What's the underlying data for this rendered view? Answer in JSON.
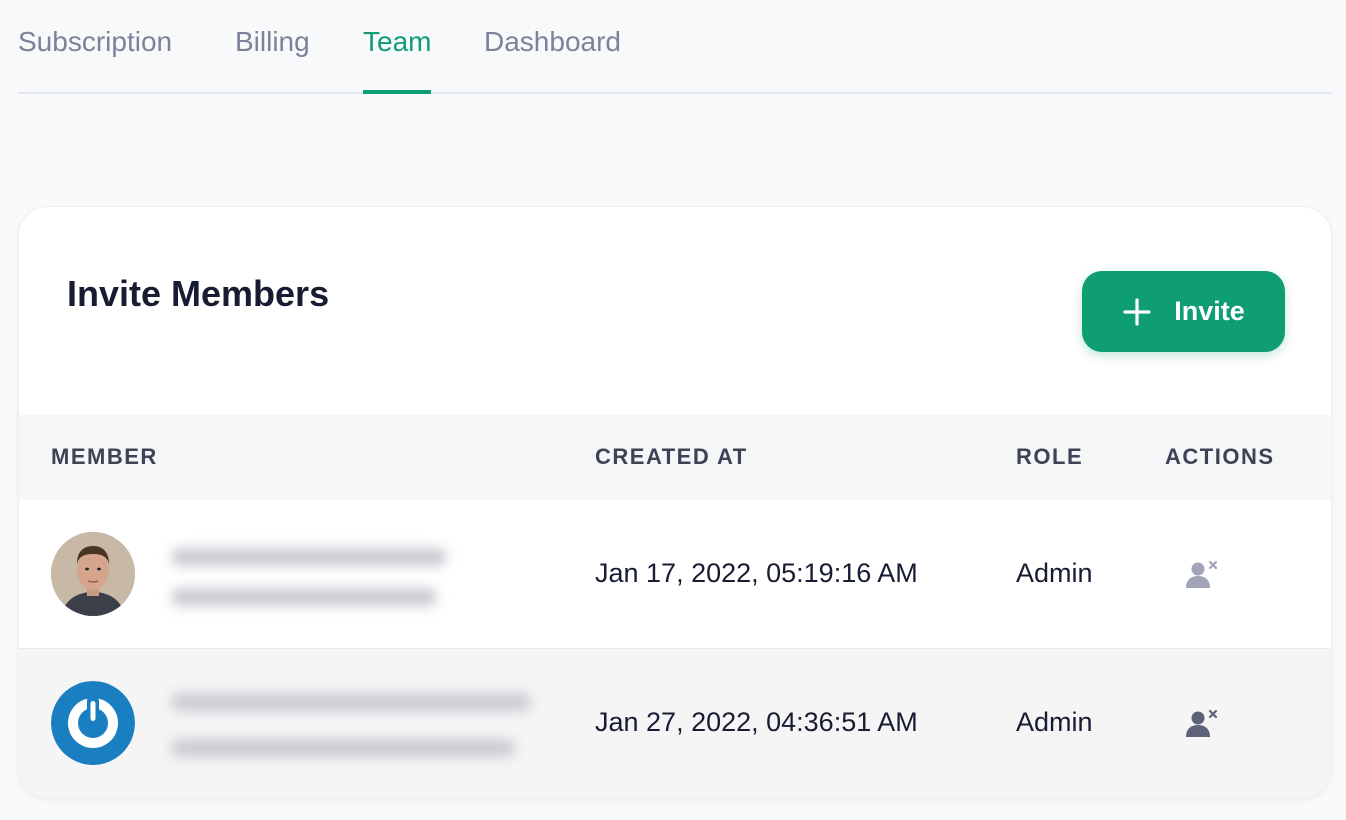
{
  "tabs": [
    {
      "label": "Subscription",
      "active": false
    },
    {
      "label": "Billing",
      "active": false
    },
    {
      "label": "Team",
      "active": true
    },
    {
      "label": "Dashboard",
      "active": false
    }
  ],
  "colors": {
    "accent": "#0f9d73",
    "text": "#181c32",
    "muted": "#7e8299",
    "icon": "#a1a5b7"
  },
  "card": {
    "title": "Invite Members",
    "invite_button": {
      "label": "Invite",
      "icon": "plus-icon"
    }
  },
  "table": {
    "columns": [
      "MEMBER",
      "CREATED AT",
      "ROLE",
      "ACTIONS"
    ],
    "rows": [
      {
        "avatar": "photo-avatar",
        "created_at": "Jan 17, 2022, 05:19:16 AM",
        "role": "Admin",
        "action_icon": "remove-user-icon"
      },
      {
        "avatar": "power-logo-avatar",
        "created_at": "Jan 27, 2022, 04:36:51 AM",
        "role": "Admin",
        "action_icon": "remove-user-icon"
      }
    ]
  }
}
